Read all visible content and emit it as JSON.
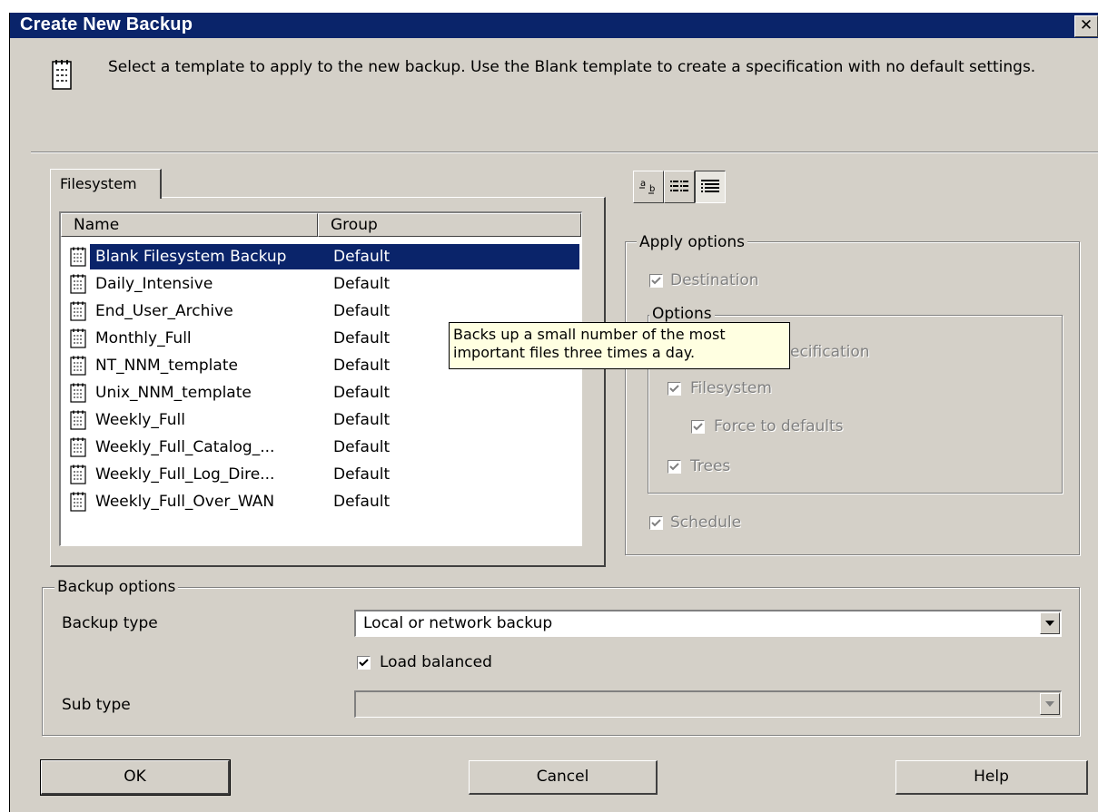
{
  "window": {
    "title": "Create New Backup",
    "close_glyph": "✕"
  },
  "intro": {
    "icon": "template-document-icon",
    "text": "Select a template to apply to the new backup. Use the Blank template to create a specification with no default settings."
  },
  "tab": {
    "label": "Filesystem"
  },
  "list": {
    "columns": [
      "Name",
      "Group"
    ],
    "rows": [
      {
        "name": "Blank Filesystem Backup",
        "group": "Default",
        "selected": true
      },
      {
        "name": "Daily_Intensive",
        "group": "Default"
      },
      {
        "name": "End_User_Archive",
        "group": "Default"
      },
      {
        "name": "Monthly_Full",
        "group": "Default"
      },
      {
        "name": "NT_NNM_template",
        "group": "Default"
      },
      {
        "name": "Unix_NNM_template",
        "group": "Default"
      },
      {
        "name": "Weekly_Full",
        "group": "Default"
      },
      {
        "name": "Weekly_Full_Catalog_...",
        "group": "Default"
      },
      {
        "name": "Weekly_Full_Log_Dire...",
        "group": "Default"
      },
      {
        "name": "Weekly_Full_Over_WAN",
        "group": "Default"
      }
    ]
  },
  "tooltip": {
    "line1": "Backs up a small number of the most",
    "line2": "important files three times a day."
  },
  "view_buttons": [
    "large-icons-view-icon",
    "list-view-icon",
    "details-view-icon"
  ],
  "apply_options": {
    "legend": "Apply options",
    "destination": "Destination",
    "options_legend": "Options",
    "specification": "ecification",
    "filesystem": "Filesystem",
    "force_defaults": "Force to defaults",
    "trees": "Trees",
    "schedule": "Schedule"
  },
  "backup_options": {
    "legend": "Backup options",
    "type_label": "Backup type",
    "type_value": "Local or network backup",
    "load_balanced": "Load balanced",
    "subtype_label": "Sub type",
    "subtype_value": ""
  },
  "buttons": {
    "ok": "OK",
    "cancel": "Cancel",
    "help": "Help"
  },
  "colors": {
    "dialog_bg": "#d4d0c8",
    "selection": "#0a246a",
    "title_bar": "#0a246a",
    "tooltip_bg": "#ffffe1"
  }
}
